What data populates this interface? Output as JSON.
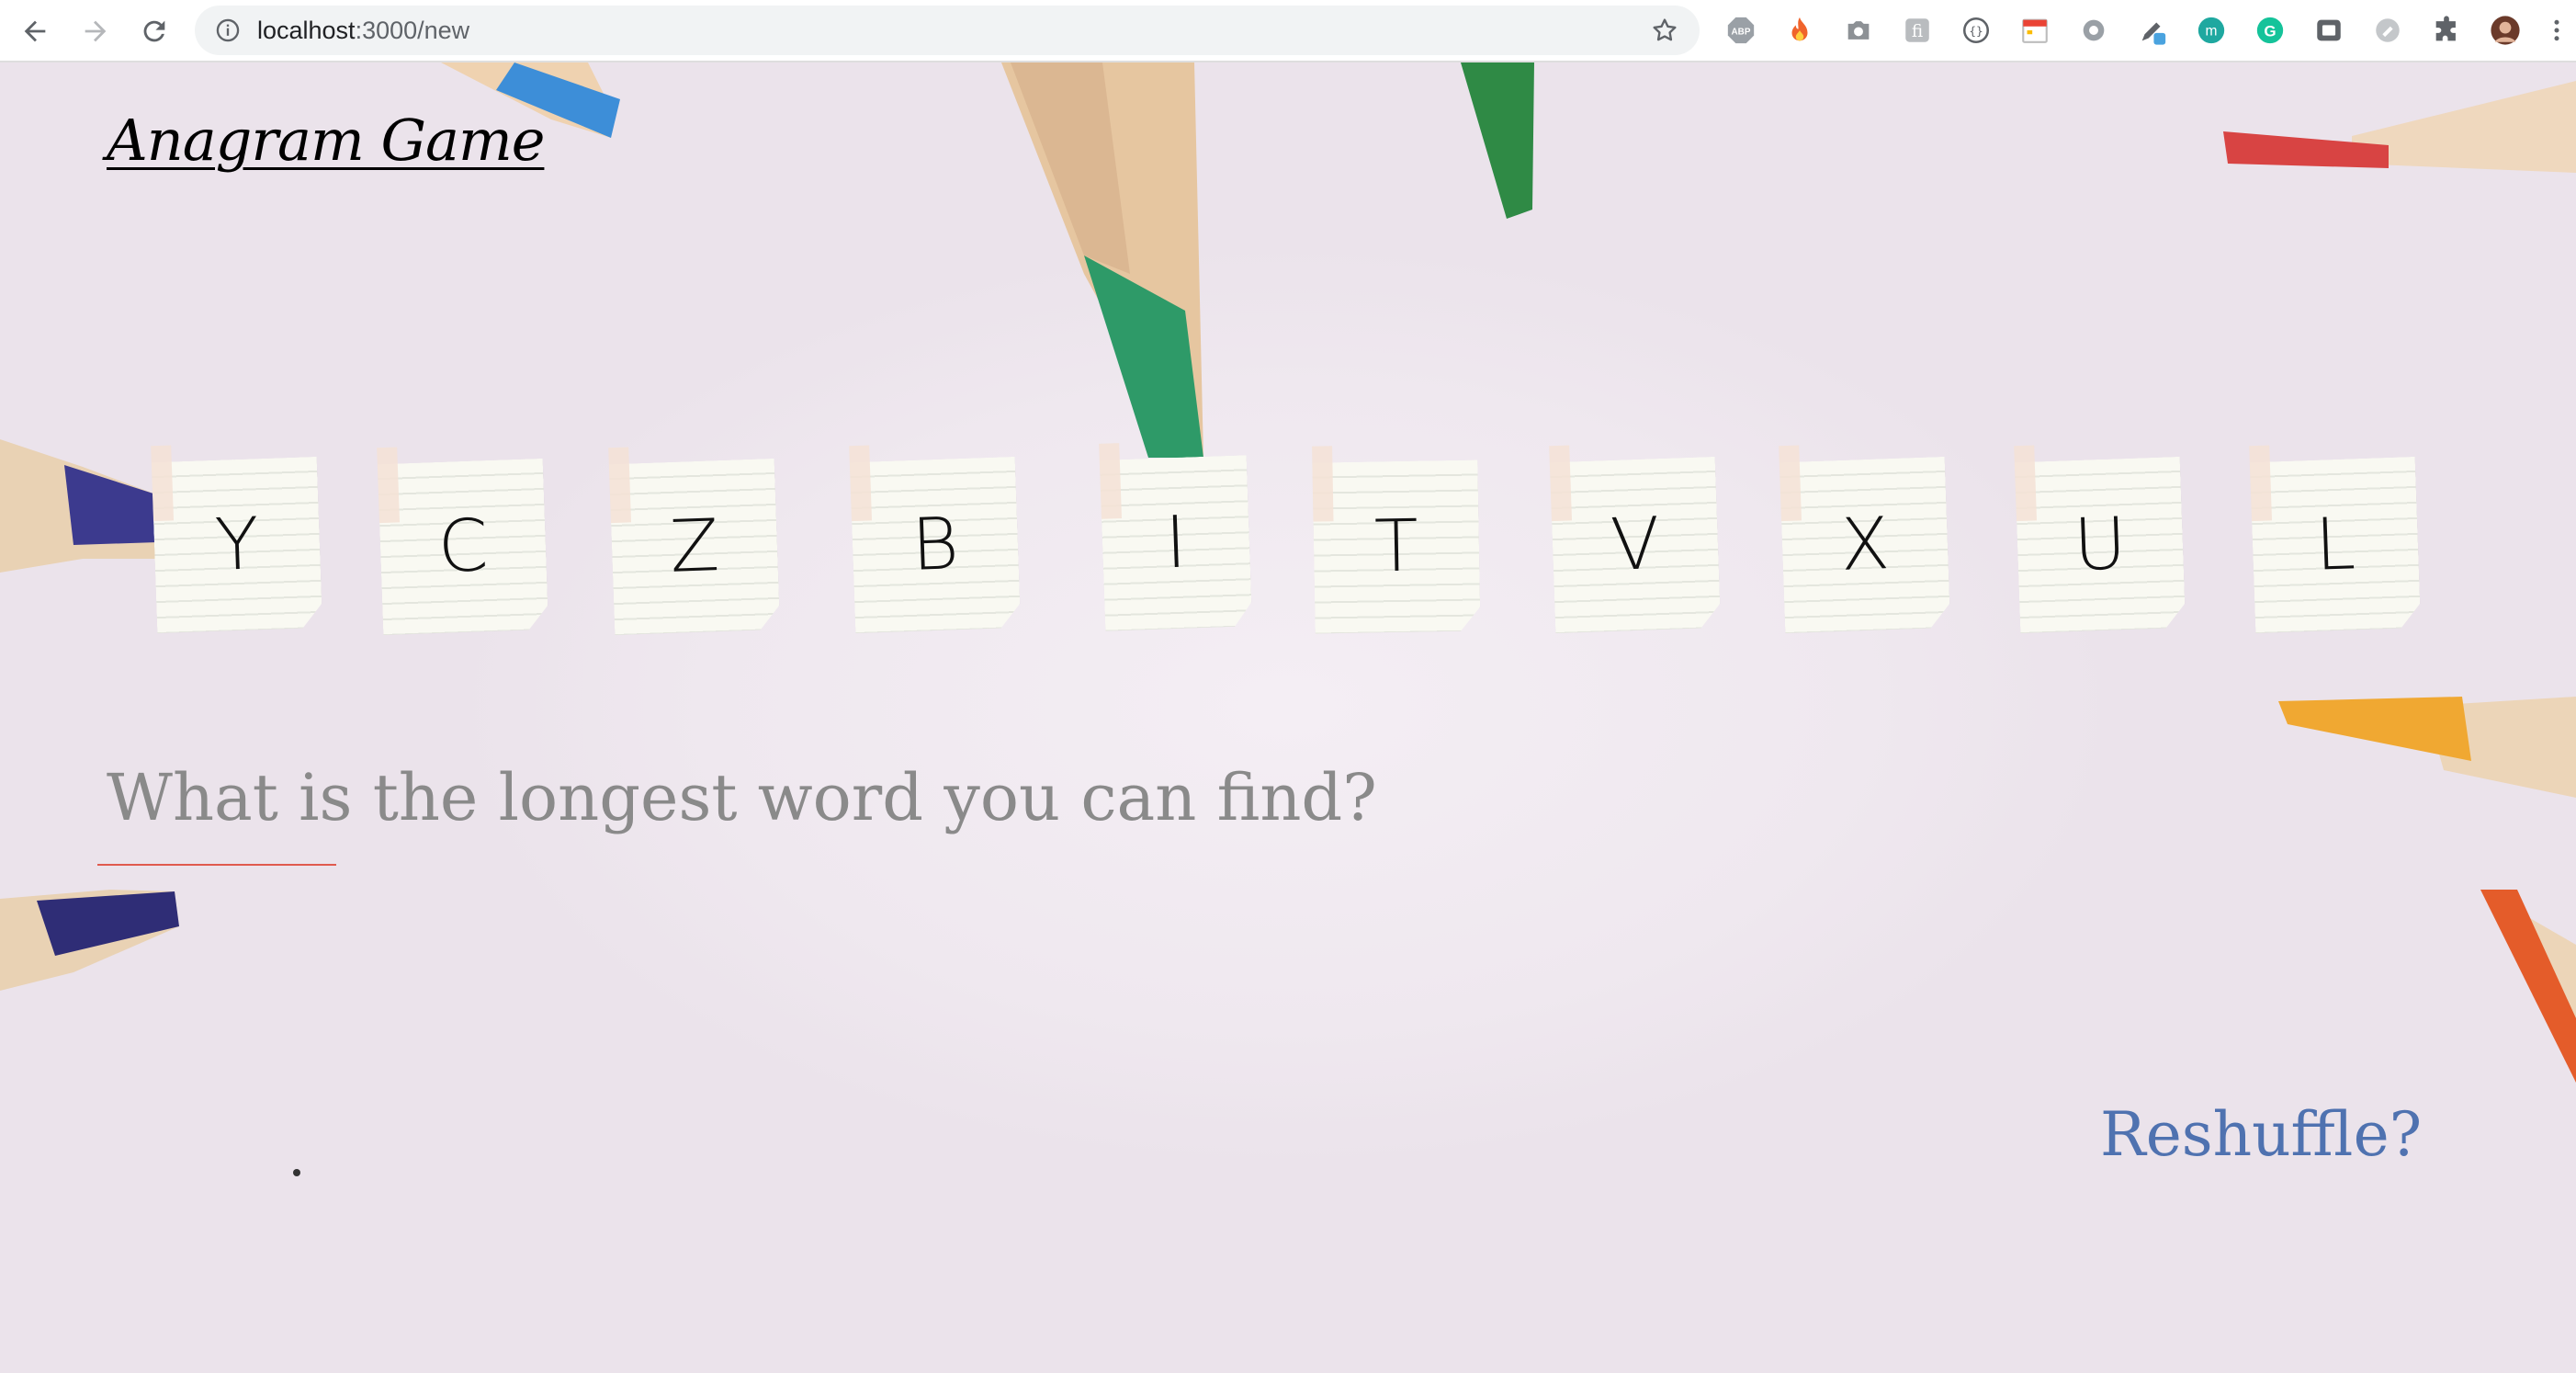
{
  "browser": {
    "url_host": "localhost",
    "url_path": ":3000/new"
  },
  "page": {
    "title": "Anagram Game",
    "letters": [
      "Y",
      "C",
      "Z",
      "B",
      "I",
      "T",
      "V",
      "X",
      "U",
      "L"
    ],
    "prompt_placeholder": "What is the longest word you can find?",
    "reshuffle_label": "Reshuffle?"
  }
}
